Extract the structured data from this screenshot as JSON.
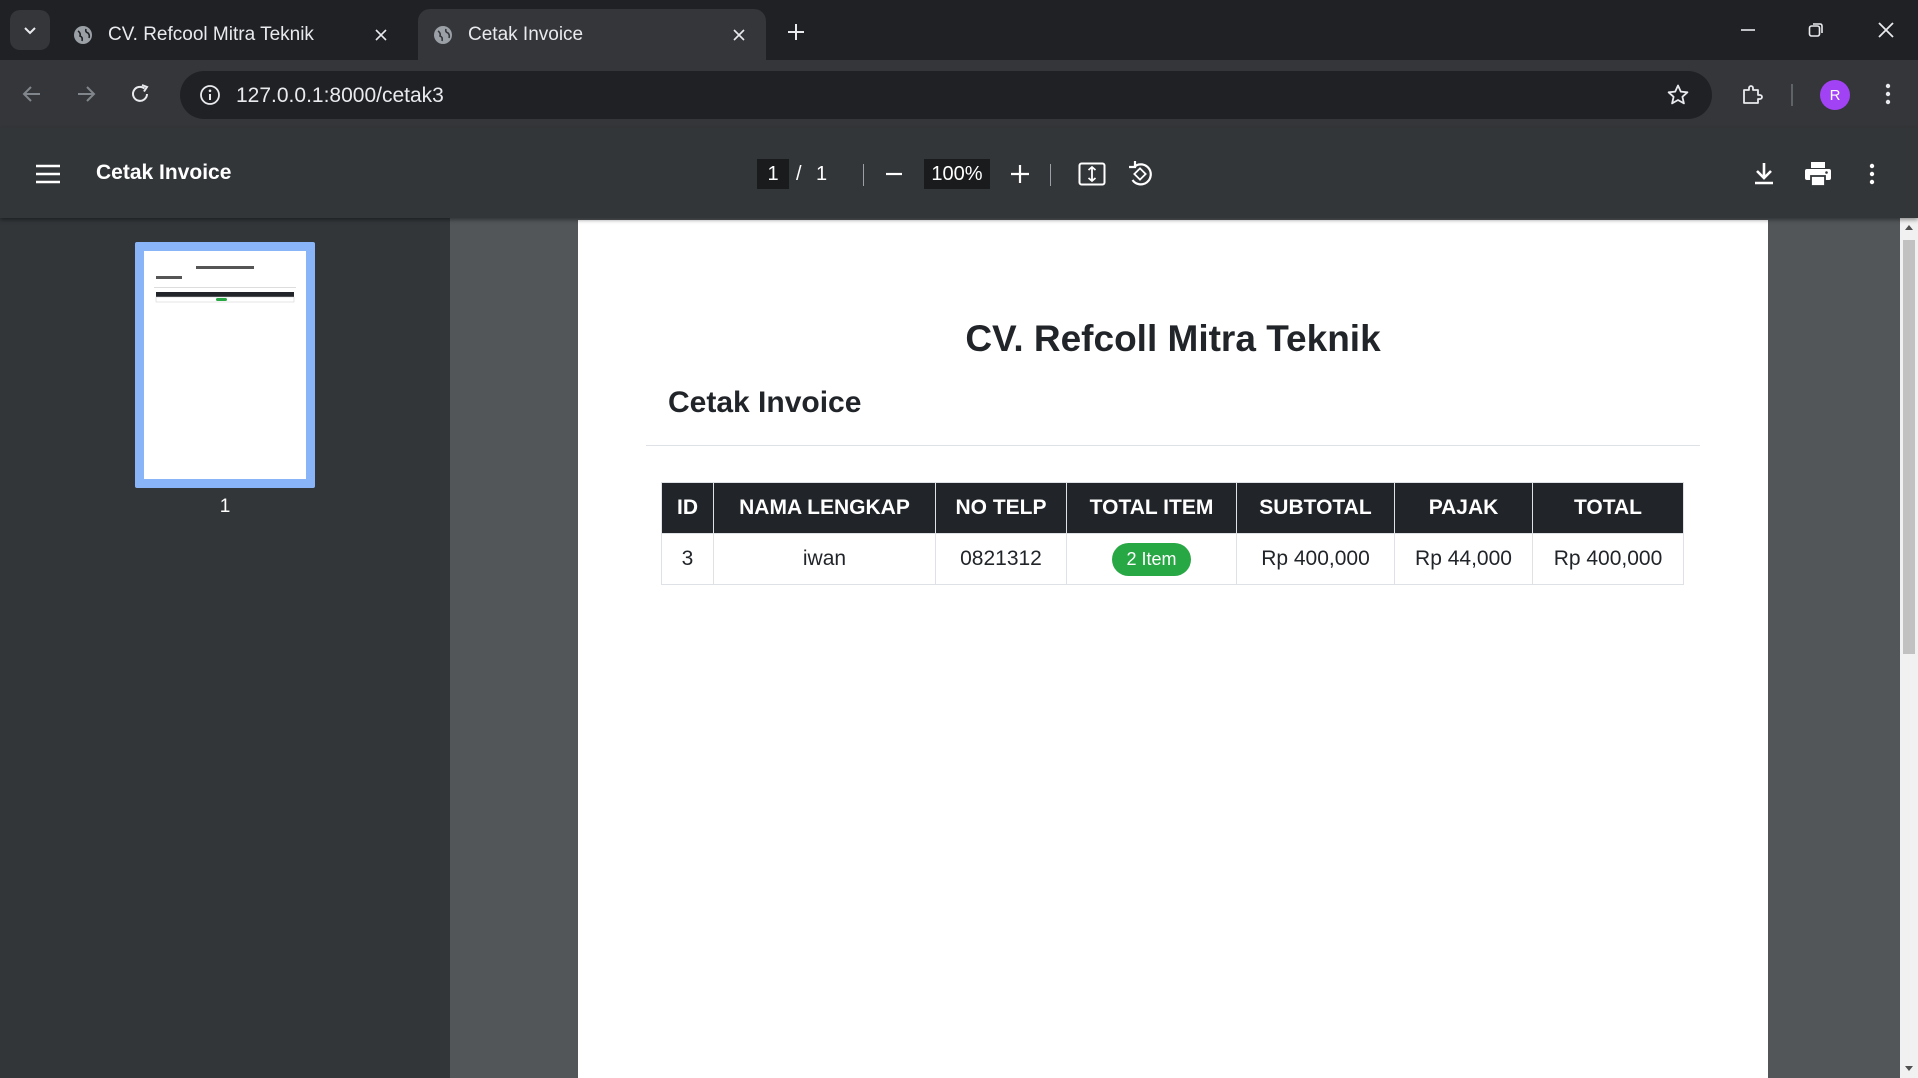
{
  "browser": {
    "tabs": [
      {
        "title": "CV. Refcool Mitra Teknik",
        "active": false
      },
      {
        "title": "Cetak Invoice",
        "active": true
      }
    ],
    "url": "127.0.0.1:8000/cetak3",
    "profile_initial": "R"
  },
  "pdf_viewer": {
    "title": "Cetak Invoice",
    "current_page": "1",
    "page_separator": "/",
    "total_pages": "1",
    "zoom": "100%",
    "thumbnail_label": "1"
  },
  "document": {
    "company": "CV. Refcoll Mitra Teknik",
    "subtitle": "Cetak Invoice",
    "table": {
      "headers": [
        "ID",
        "NAMA LENGKAP",
        "NO TELP",
        "TOTAL ITEM",
        "SUBTOTAL",
        "PAJAK",
        "TOTAL"
      ],
      "rows": [
        {
          "id": "3",
          "name": "iwan",
          "phone": "0821312",
          "total_item": "2 Item",
          "subtotal": "Rp 400,000",
          "tax": "Rp 44,000",
          "total": "Rp 400,000"
        }
      ]
    }
  },
  "colors": {
    "header_bg": "#212529",
    "badge_green": "#28a745",
    "avatar_purple": "#a142f4",
    "thumb_highlight": "#8ab4f8"
  }
}
